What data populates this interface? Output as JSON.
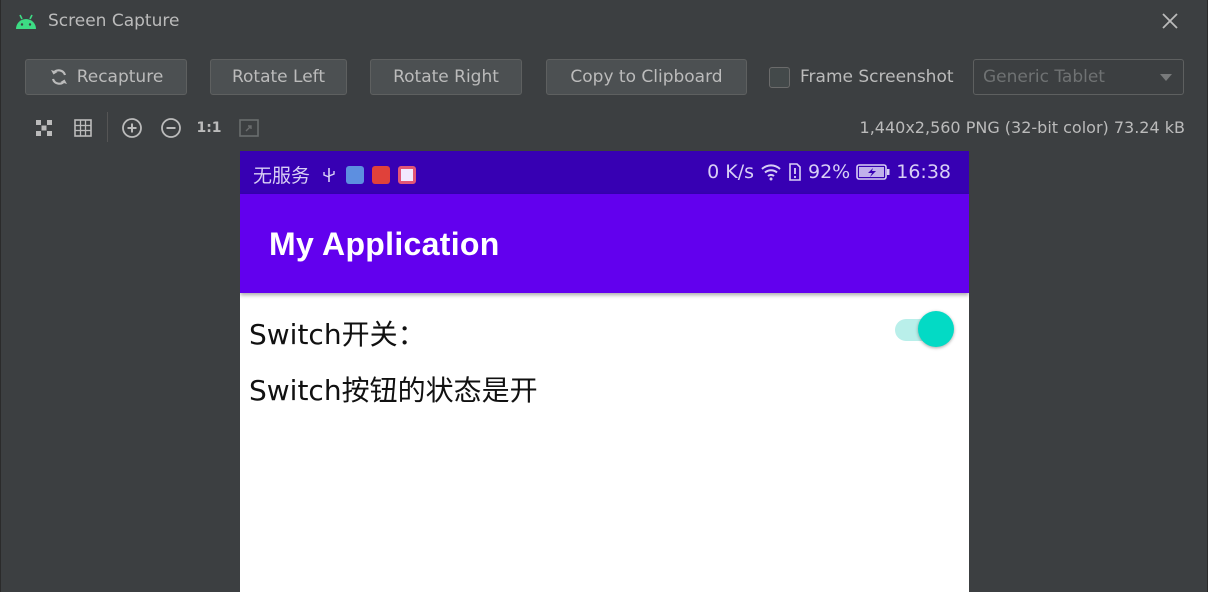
{
  "window": {
    "title": "Screen Capture",
    "app_icon": "android-icon",
    "close_icon": "close-icon"
  },
  "toolbar": {
    "recapture_label": "Recapture",
    "rotate_left_label": "Rotate Left",
    "rotate_right_label": "Rotate Right",
    "copy_label": "Copy to Clipboard",
    "frame_label": "Frame Screenshot",
    "frame_checked": false,
    "device_select_value": "Generic Tablet"
  },
  "view_tools": [
    "fit-icon",
    "grid-icon",
    "zoom-in-icon",
    "zoom-out-icon",
    "actual-size-icon",
    "frame-toggle-icon"
  ],
  "actual_size_label": "1:1",
  "image_info": "1,440x2,560 PNG (32-bit color) 73.24 kB",
  "phone": {
    "status_bar": {
      "carrier": "无服务",
      "speed": "0 K/s",
      "battery": "92%",
      "time": "16:38"
    },
    "app_title": "My Application",
    "switch_label": "Switch开关：",
    "switch_on": true,
    "status_text": "Switch按钮的状态是开",
    "colors": {
      "status_bar": "#3700b3",
      "app_bar": "#6200ee",
      "switch_thumb": "#03dac5",
      "switch_track": "#b9efea"
    }
  }
}
